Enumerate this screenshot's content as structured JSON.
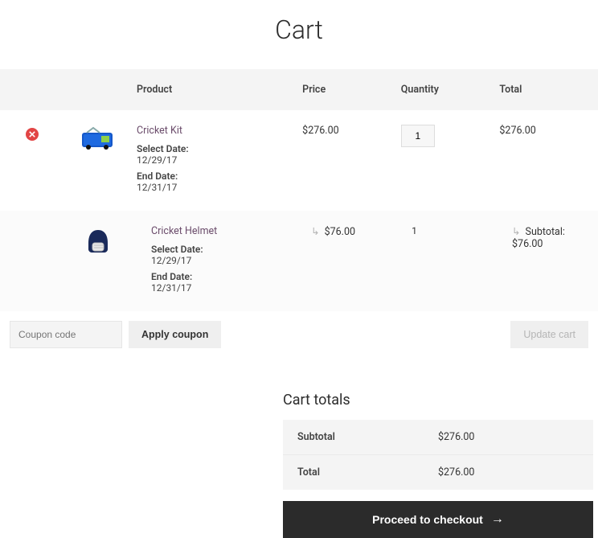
{
  "page_title": "Cart",
  "headers": {
    "product": "Product",
    "price": "Price",
    "quantity": "Quantity",
    "total": "Total"
  },
  "items": [
    {
      "name": "Cricket Kit",
      "select_date_label": "Select Date:",
      "select_date": "12/29/17",
      "end_date_label": "End Date:",
      "end_date": "12/31/17",
      "price": "$276.00",
      "quantity": "1",
      "total": "$276.00",
      "removable": true
    },
    {
      "name": "Cricket Helmet",
      "select_date_label": "Select Date:",
      "select_date": "12/29/17",
      "end_date_label": "End Date:",
      "end_date": "12/31/17",
      "price": "$76.00",
      "quantity": "1",
      "subtotal_label": "Subtotal:",
      "subtotal": "$76.00",
      "removable": false
    }
  ],
  "coupon": {
    "placeholder": "Coupon code",
    "apply_label": "Apply coupon"
  },
  "update_label": "Update cart",
  "totals": {
    "heading": "Cart totals",
    "subtotal_label": "Subtotal",
    "subtotal": "$276.00",
    "total_label": "Total",
    "total": "$276.00"
  },
  "checkout_label": "Proceed to checkout"
}
